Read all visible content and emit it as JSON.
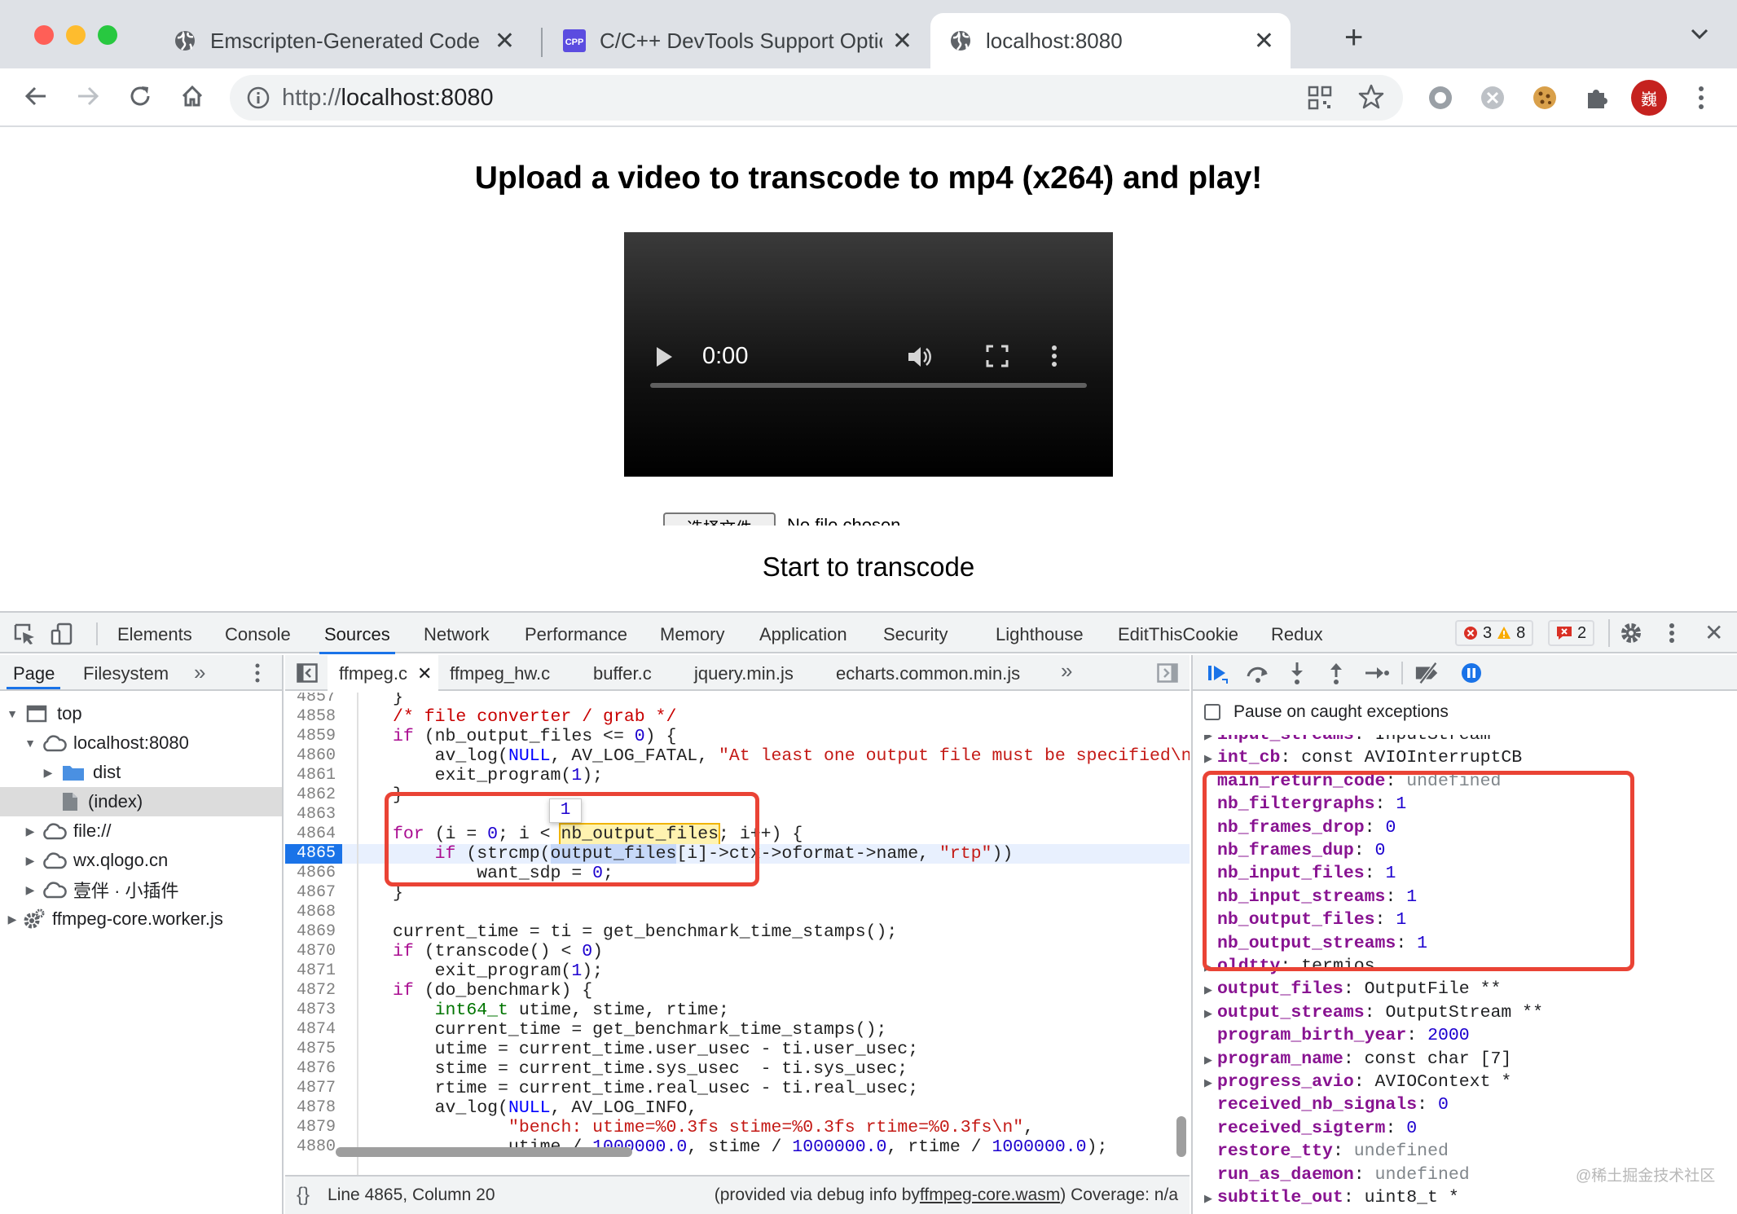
{
  "browser": {
    "tabs": [
      {
        "label": "Emscripten-Generated Code",
        "icon": "globe-icon"
      },
      {
        "label": "C/C++ DevTools Support Option",
        "icon": "cpp-extension-icon"
      },
      {
        "label": "localhost:8080",
        "icon": "globe-icon"
      }
    ],
    "url_protocol": "http://",
    "url_host": "localhost:8080",
    "profile_initial": "巍",
    "colors": {
      "tab_bar": "#dee1e6",
      "active_tab": "#ffffff",
      "accent": "#1a73e8",
      "annotation": "#ea4335",
      "profile": "#c5221f"
    }
  },
  "page": {
    "title": "Upload a video to transcode to mp4 (x264) and play!",
    "video_time": "0:00",
    "file_button": "选择文件",
    "file_status": "No file chosen",
    "transcode_button": "Start to transcode"
  },
  "devtools": {
    "tabs": [
      "Elements",
      "Console",
      "Sources",
      "Network",
      "Performance",
      "Memory",
      "Application",
      "Security",
      "Lighthouse",
      "EditThisCookie",
      "Redux"
    ],
    "active_tab": "Sources",
    "errors": "3",
    "warnings": "8",
    "issues": "2",
    "navigator": {
      "tabs": [
        "Page",
        "Filesystem"
      ],
      "tree": [
        "top",
        "localhost:8080",
        "dist",
        "(index)",
        "file://",
        "wx.qlogo.cn",
        "壹伴 · 小插件",
        "ffmpeg-core.worker.js"
      ]
    },
    "editor": {
      "files": [
        "ffmpeg.c",
        "ffmpeg_hw.c",
        "buffer.c",
        "jquery.min.js",
        "echarts.common.min.js"
      ],
      "line_numbers": [
        "4857",
        "4858",
        "4859",
        "4860",
        "4861",
        "4862",
        "4863",
        "4864",
        "4865",
        "4866",
        "4867",
        "4868",
        "4869",
        "4870",
        "4871",
        "4872",
        "4873",
        "4874",
        "4875",
        "4876",
        "4877",
        "4878",
        "4879",
        "4880"
      ],
      "hover_value": "1",
      "status_position": "Line 4865, Column 20",
      "status_source_prefix": "(provided via debug info by ",
      "status_source_file": "ffmpeg-core.wasm",
      "status_coverage": ") Coverage: n/a"
    },
    "debugger": {
      "pause_on_caught": "Pause on caught exceptions",
      "scope": [
        {
          "name": "input_streams",
          "value": "InputStream **",
          "expandable": true
        },
        {
          "name": "int_cb",
          "value": "const AVIOInterruptCB",
          "expandable": true
        },
        {
          "name": "main_return_code",
          "value": "undefined",
          "expandable": false
        },
        {
          "name": "nb_filtergraphs",
          "value": "1",
          "expandable": false
        },
        {
          "name": "nb_frames_drop",
          "value": "0",
          "expandable": false
        },
        {
          "name": "nb_frames_dup",
          "value": "0",
          "expandable": false
        },
        {
          "name": "nb_input_files",
          "value": "1",
          "expandable": false
        },
        {
          "name": "nb_input_streams",
          "value": "1",
          "expandable": false
        },
        {
          "name": "nb_output_files",
          "value": "1",
          "expandable": false
        },
        {
          "name": "nb_output_streams",
          "value": "1",
          "expandable": false
        },
        {
          "name": "oldtty",
          "value": "termios",
          "expandable": true
        },
        {
          "name": "output_files",
          "value": "OutputFile **",
          "expandable": true
        },
        {
          "name": "output_streams",
          "value": "OutputStream **",
          "expandable": true
        },
        {
          "name": "program_birth_year",
          "value": "2000",
          "expandable": false
        },
        {
          "name": "program_name",
          "value": "const char [7]",
          "expandable": true
        },
        {
          "name": "progress_avio",
          "value": "AVIOContext *",
          "expandable": true
        },
        {
          "name": "received_nb_signals",
          "value": "0",
          "expandable": false
        },
        {
          "name": "received_sigterm",
          "value": "0",
          "expandable": false
        },
        {
          "name": "restore_tty",
          "value": "undefined",
          "expandable": false
        },
        {
          "name": "run_as_daemon",
          "value": "undefined",
          "expandable": false
        },
        {
          "name": "subtitle_out",
          "value": "uint8_t *",
          "expandable": true
        }
      ]
    }
  },
  "watermark": "@稀土掘金技术社区"
}
